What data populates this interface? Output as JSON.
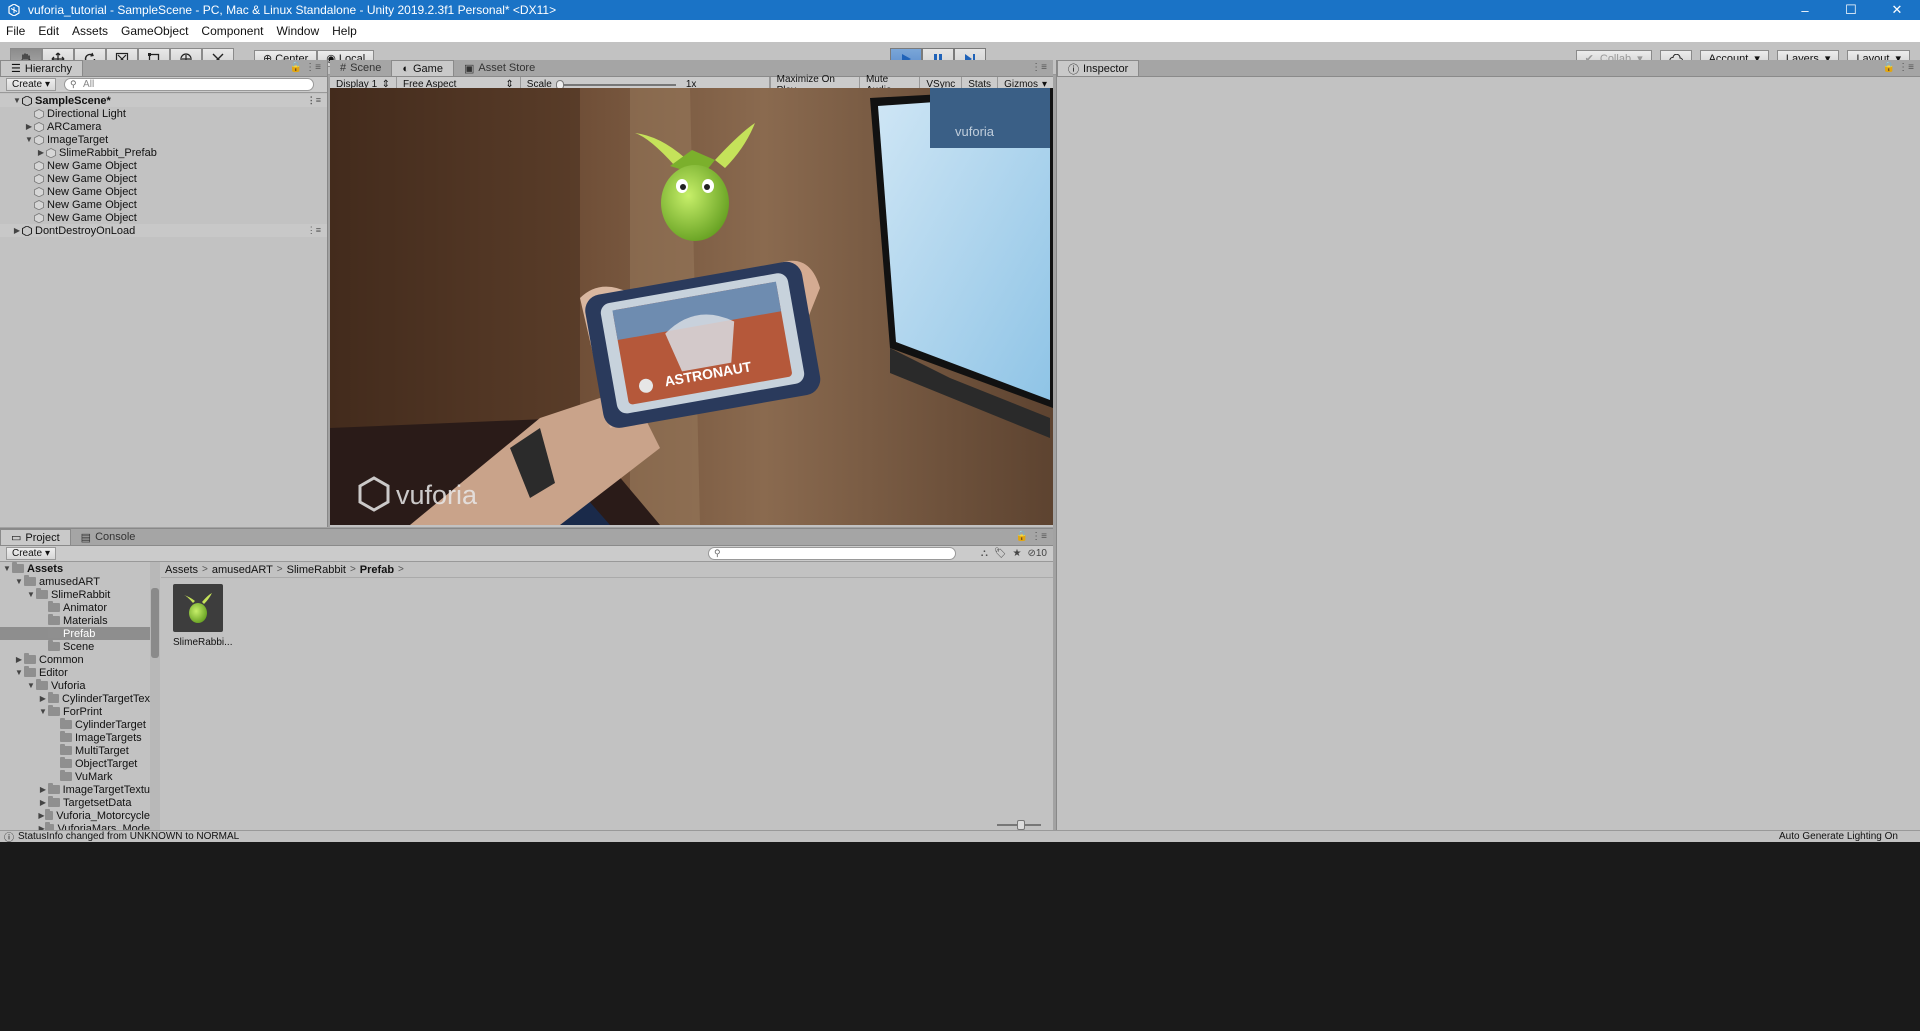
{
  "window": {
    "title": "vuforia_tutorial - SampleScene - PC, Mac & Linux Standalone - Unity 2019.2.3f1 Personal* <DX11>",
    "controls": [
      "–",
      "☐",
      "✕"
    ]
  },
  "menu": [
    "File",
    "Edit",
    "Assets",
    "GameObject",
    "Component",
    "Window",
    "Help"
  ],
  "toolbar": {
    "tools": [
      "hand-icon",
      "move-icon",
      "rotate-icon",
      "scale-icon",
      "rect-icon",
      "transform-icon",
      "custom-tool-icon"
    ],
    "pivot": "Center",
    "space": "Local",
    "collab": "Collab",
    "account": "Account",
    "layers": "Layers",
    "layout": "Layout"
  },
  "hierarchy": {
    "tab": "Hierarchy",
    "create": "Create",
    "search_placeholder": "All",
    "scene": "SampleScene*",
    "items": [
      {
        "label": "Directional Light",
        "indent": 1,
        "arrow": ""
      },
      {
        "label": "ARCamera",
        "indent": 1,
        "arrow": "▶"
      },
      {
        "label": "ImageTarget",
        "indent": 1,
        "arrow": "▼"
      },
      {
        "label": "SlimeRabbit_Prefab",
        "indent": 2,
        "arrow": "▶"
      },
      {
        "label": "New Game Object",
        "indent": 1,
        "arrow": ""
      },
      {
        "label": "New Game Object",
        "indent": 1,
        "arrow": ""
      },
      {
        "label": "New Game Object",
        "indent": 1,
        "arrow": ""
      },
      {
        "label": "New Game Object",
        "indent": 1,
        "arrow": ""
      },
      {
        "label": "New Game Object",
        "indent": 1,
        "arrow": ""
      }
    ],
    "scene2": "DontDestroyOnLoad"
  },
  "center_tabs": {
    "scene": "Scene",
    "game": "Game",
    "asset_store": "Asset Store"
  },
  "game_bar": {
    "display": "Display 1",
    "aspect": "Free Aspect",
    "scale_label": "Scale",
    "scale_value": "1x",
    "maximize": "Maximize On Play",
    "mute": "Mute Audio",
    "vsync": "VSync",
    "stats": "Stats",
    "gizmos": "Gizmos"
  },
  "viewport": {
    "phone_text": "ASTRONAUT",
    "watermark": "vuforia",
    "monitor_text": "vuforia"
  },
  "inspector": {
    "tab": "Inspector"
  },
  "project": {
    "tab_project": "Project",
    "tab_console": "Console",
    "create": "Create",
    "badge_count": "10",
    "tree": [
      {
        "label": "Assets",
        "indent": 0,
        "arrow": "▼",
        "bold": true,
        "sel": false
      },
      {
        "label": "amusedART",
        "indent": 1,
        "arrow": "▼",
        "bold": false,
        "sel": false
      },
      {
        "label": "SlimeRabbit",
        "indent": 2,
        "arrow": "▼",
        "bold": false,
        "sel": false
      },
      {
        "label": "Animator",
        "indent": 3,
        "arrow": "",
        "bold": false,
        "sel": false
      },
      {
        "label": "Materials",
        "indent": 3,
        "arrow": "",
        "bold": false,
        "sel": false
      },
      {
        "label": "Prefab",
        "indent": 3,
        "arrow": "",
        "bold": false,
        "sel": true
      },
      {
        "label": "Scene",
        "indent": 3,
        "arrow": "",
        "bold": false,
        "sel": false
      },
      {
        "label": "Common",
        "indent": 1,
        "arrow": "▶",
        "bold": false,
        "sel": false
      },
      {
        "label": "Editor",
        "indent": 1,
        "arrow": "▼",
        "bold": false,
        "sel": false
      },
      {
        "label": "Vuforia",
        "indent": 2,
        "arrow": "▼",
        "bold": false,
        "sel": false
      },
      {
        "label": "CylinderTargetTex",
        "indent": 3,
        "arrow": "▶",
        "bold": false,
        "sel": false
      },
      {
        "label": "ForPrint",
        "indent": 3,
        "arrow": "▼",
        "bold": false,
        "sel": false
      },
      {
        "label": "CylinderTarget",
        "indent": 4,
        "arrow": "",
        "bold": false,
        "sel": false
      },
      {
        "label": "ImageTargets",
        "indent": 4,
        "arrow": "",
        "bold": false,
        "sel": false
      },
      {
        "label": "MultiTarget",
        "indent": 4,
        "arrow": "",
        "bold": false,
        "sel": false
      },
      {
        "label": "ObjectTarget",
        "indent": 4,
        "arrow": "",
        "bold": false,
        "sel": false
      },
      {
        "label": "VuMark",
        "indent": 4,
        "arrow": "",
        "bold": false,
        "sel": false
      },
      {
        "label": "ImageTargetTextu",
        "indent": 3,
        "arrow": "▶",
        "bold": false,
        "sel": false
      },
      {
        "label": "TargetsetData",
        "indent": 3,
        "arrow": "▶",
        "bold": false,
        "sel": false
      },
      {
        "label": "Vuforia_Motorcycle",
        "indent": 3,
        "arrow": "▶",
        "bold": false,
        "sel": false
      },
      {
        "label": "VuforiaMars_Mode",
        "indent": 3,
        "arrow": "▶",
        "bold": false,
        "sel": false
      }
    ],
    "breadcrumb": [
      "Assets",
      "amusedART",
      "SlimeRabbit",
      "Prefab"
    ],
    "asset_name": "SlimeRabbi..."
  },
  "status": {
    "message": "StatusInfo changed from UNKNOWN to NORMAL",
    "right": "Auto Generate Lighting On"
  },
  "colors": {
    "titlebar": "#1a73c6",
    "panel": "#c2c2c2",
    "play_active": "#5b8ccc",
    "selection": "#8e8e8e"
  }
}
